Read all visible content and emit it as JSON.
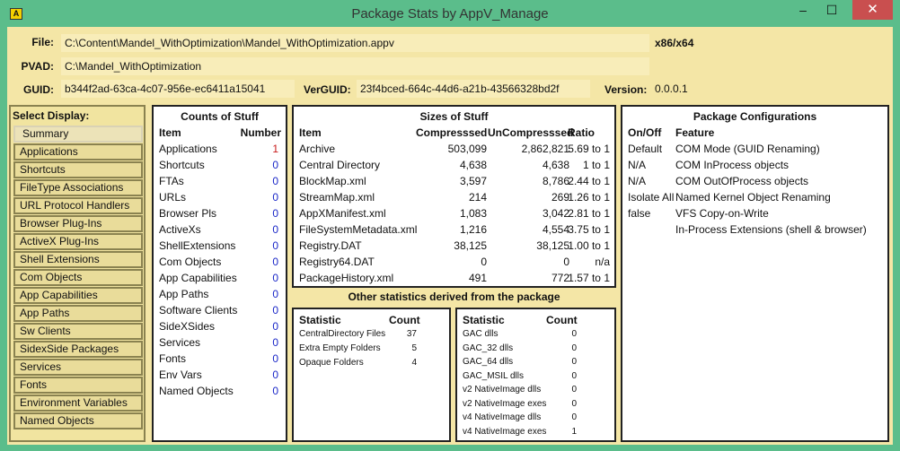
{
  "window": {
    "title": "Package Stats by AppV_Manage",
    "icon": "app-package-icon",
    "minimize": "minimize-icon",
    "maximize": "maximize-icon",
    "close": "close-icon"
  },
  "header": {
    "file_label": "File:",
    "file": "C:\\Content\\Mandel_WithOptimization\\Mandel_WithOptimization.appv",
    "arch": "x86/x64",
    "pvad_label": "PVAD:",
    "pvad": "C:\\Mandel_WithOptimization",
    "guid_label": "GUID:",
    "guid": "b344f2ad-63ca-4c07-956e-ec6411a15041",
    "verguid_label": "VerGUID:",
    "verguid": "23f4bced-664c-44d6-a21b-43566328bd2f",
    "version_label": "Version:",
    "version": "0.0.0.1"
  },
  "sidebar": {
    "title": "Select Display:",
    "selected": "Summary",
    "items": [
      "Summary",
      "Applications",
      "Shortcuts",
      "FileType Associations",
      "URL Protocol Handlers",
      "Browser Plug-Ins",
      "ActiveX Plug-Ins",
      "Shell Extensions",
      "Com Objects",
      "App Capabilities",
      "App Paths",
      "Sw Clients",
      "SidexSide Packages",
      "Services",
      "Fonts",
      "Environment Variables",
      "Named Objects"
    ]
  },
  "counts": {
    "title": "Counts of Stuff",
    "col_item": "Item",
    "col_number": "Number",
    "rows": [
      {
        "item": "Applications",
        "number": "1"
      },
      {
        "item": "Shortcuts",
        "number": "0"
      },
      {
        "item": "FTAs",
        "number": "0"
      },
      {
        "item": "URLs",
        "number": "0"
      },
      {
        "item": "Browser Pls",
        "number": "0"
      },
      {
        "item": "ActiveXs",
        "number": "0"
      },
      {
        "item": "ShellExtensions",
        "number": "0"
      },
      {
        "item": "Com Objects",
        "number": "0"
      },
      {
        "item": "App Capabilities",
        "number": "0"
      },
      {
        "item": "App Paths",
        "number": "0"
      },
      {
        "item": "Software Clients",
        "number": "0"
      },
      {
        "item": "SideXSides",
        "number": "0"
      },
      {
        "item": "Services",
        "number": "0"
      },
      {
        "item": "Fonts",
        "number": "0"
      },
      {
        "item": "Env Vars",
        "number": "0"
      },
      {
        "item": "Named Objects",
        "number": "0"
      }
    ],
    "colors": {
      "nonzero": "#c81a1a",
      "zero": "#1a27c8"
    }
  },
  "sizes": {
    "title": "Sizes of Stuff",
    "col_item": "Item",
    "col_compressed": "Compresssed",
    "col_uncompressed": "UnCompresssed",
    "col_ratio": "Ratio",
    "rows": [
      {
        "item": "Archive",
        "c": "503,099",
        "u": "2,862,821",
        "r": "5.69 to 1"
      },
      {
        "item": "Central Directory",
        "c": "4,638",
        "u": "4,638",
        "r": "1 to 1"
      },
      {
        "item": "BlockMap.xml",
        "c": "3,597",
        "u": "8,786",
        "r": "2.44 to 1"
      },
      {
        "item": "StreamMap.xml",
        "c": "214",
        "u": "269",
        "r": "1.26 to 1"
      },
      {
        "item": "AppXManifest.xml",
        "c": "1,083",
        "u": "3,042",
        "r": "2.81 to 1"
      },
      {
        "item": "FileSystemMetadata.xml",
        "c": "1,216",
        "u": "4,554",
        "r": "3.75 to 1"
      },
      {
        "item": "Registry.DAT",
        "c": "38,125",
        "u": "38,125",
        "r": "1.00 to 1"
      },
      {
        "item": "Registry64.DAT",
        "c": "0",
        "u": "0",
        "r": "n/a"
      },
      {
        "item": "PackageHistory.xml",
        "c": "491",
        "u": "772",
        "r": "1.57 to 1"
      }
    ]
  },
  "other": {
    "title": "Other statistics derived from the package",
    "left": {
      "col_stat": "Statistic",
      "col_count": "Count",
      "rows": [
        {
          "s": "CentralDirectory Files",
          "c": "37"
        },
        {
          "s": "Extra Empty Folders",
          "c": "5"
        },
        {
          "s": "Opaque Folders",
          "c": "4"
        }
      ]
    },
    "right": {
      "col_stat": "Statistic",
      "col_count": "Count",
      "rows": [
        {
          "s": "GAC dlls",
          "c": "0"
        },
        {
          "s": "GAC_32 dlls",
          "c": "0"
        },
        {
          "s": "GAC_64 dlls",
          "c": "0"
        },
        {
          "s": "GAC_MSIL dlls",
          "c": "0"
        },
        {
          "s": "v2 NativeImage dlls",
          "c": "0"
        },
        {
          "s": "v2 NativeImage exes",
          "c": "0"
        },
        {
          "s": "v4 NativeImage dlls",
          "c": "0"
        },
        {
          "s": "v4 NativeImage exes",
          "c": "1"
        }
      ]
    }
  },
  "config": {
    "title": "Package Configurations",
    "col_onoff": "On/Off",
    "col_feature": "Feature",
    "rows": [
      {
        "v": "Default",
        "f": "COM Mode (GUID Renaming)"
      },
      {
        "v": "N/A",
        "f": "COM InProcess objects"
      },
      {
        "v": "N/A",
        "f": "COM OutOfProcess objects"
      },
      {
        "v": "Isolate All",
        "f": "Named Kernel Object Renaming"
      },
      {
        "v": "false",
        "f": "VFS Copy-on-Write"
      },
      {
        "v": "",
        "f": "In-Process Extensions (shell & browser)"
      }
    ]
  }
}
